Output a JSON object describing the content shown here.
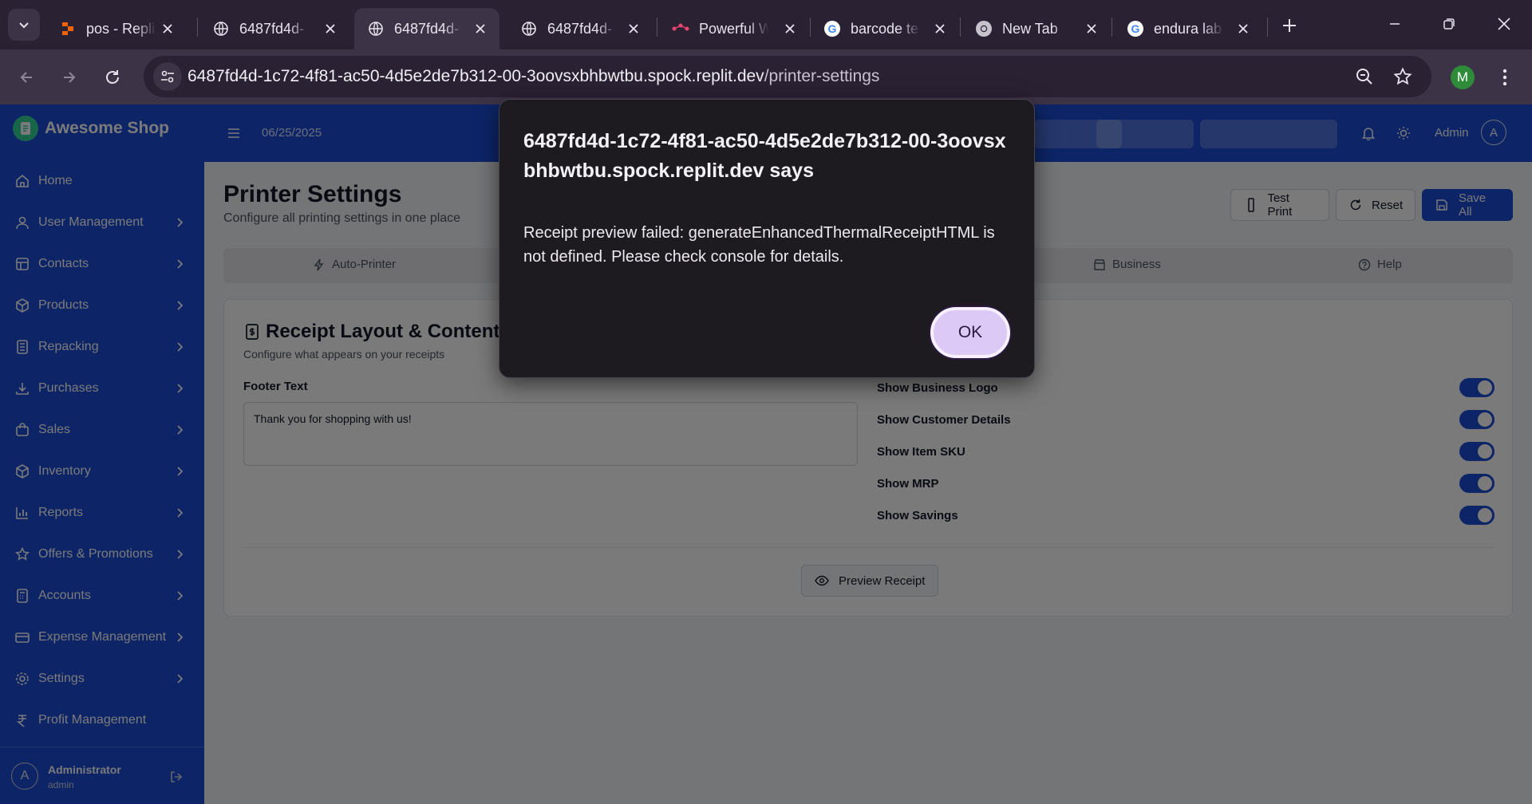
{
  "browser": {
    "tabs": [
      {
        "title": "pos - Replit",
        "icon": "replit-icon",
        "active": false
      },
      {
        "title": "6487fd4d-",
        "icon": "globe-icon",
        "active": false
      },
      {
        "title": "6487fd4d-",
        "icon": "globe-icon",
        "active": true
      },
      {
        "title": "6487fd4d-",
        "icon": "globe-icon",
        "active": false
      },
      {
        "title": "Powerful W",
        "icon": "flow-icon",
        "active": false
      },
      {
        "title": "barcode te",
        "icon": "google-icon",
        "active": false
      },
      {
        "title": "New Tab",
        "icon": "chrome-icon",
        "active": false
      },
      {
        "title": "endura lab",
        "icon": "google-icon",
        "active": false
      }
    ],
    "url_host": "6487fd4d-1c72-4f81-ac50-4d5e2de7b312-00-3oovsxbhbwtbu.spock.replit.dev",
    "url_path": "/printer-settings",
    "profile_initial": "M"
  },
  "app": {
    "brand": "Awesome Shop",
    "date": "06/25/2025",
    "top_user": "Admin",
    "top_avatar": "A",
    "nav": [
      {
        "label": "Home",
        "icon": "home-icon",
        "chevron": false
      },
      {
        "label": "User Management",
        "icon": "user-icon",
        "chevron": true
      },
      {
        "label": "Contacts",
        "icon": "contacts-icon",
        "chevron": true
      },
      {
        "label": "Products",
        "icon": "box-icon",
        "chevron": true
      },
      {
        "label": "Repacking",
        "icon": "repack-icon",
        "chevron": true
      },
      {
        "label": "Purchases",
        "icon": "download-icon",
        "chevron": true
      },
      {
        "label": "Sales",
        "icon": "bag-icon",
        "chevron": true
      },
      {
        "label": "Inventory",
        "icon": "box-icon",
        "chevron": true
      },
      {
        "label": "Reports",
        "icon": "bar-chart-icon",
        "chevron": true
      },
      {
        "label": "Offers & Promotions",
        "icon": "star-icon",
        "chevron": true
      },
      {
        "label": "Accounts",
        "icon": "calculator-icon",
        "chevron": true
      },
      {
        "label": "Expense Management",
        "icon": "wallet-icon",
        "chevron": true
      },
      {
        "label": "Settings",
        "icon": "gear-icon",
        "chevron": true
      },
      {
        "label": "Profit Management",
        "icon": "rupee-icon",
        "chevron": false
      }
    ],
    "user": {
      "initial": "A",
      "name": "Administrator",
      "role": "admin"
    }
  },
  "page": {
    "title": "Printer Settings",
    "subtitle": "Configure all printing settings in one place",
    "buttons": {
      "test_print": "Test Print",
      "reset": "Reset",
      "save_all": "Save All"
    },
    "tabs": [
      {
        "label": "Auto-Printer",
        "icon": "bolt-icon"
      },
      {
        "label": "Business",
        "icon": "store-icon"
      },
      {
        "label": "Help",
        "icon": "help-icon"
      }
    ],
    "card": {
      "title": "Receipt Layout & Content",
      "subtitle": "Configure what appears on your receipts",
      "footer_label": "Footer Text",
      "footer_value": "Thank you for shopping with us!",
      "toggles": [
        {
          "label": "Show Business Logo",
          "on": true
        },
        {
          "label": "Show Customer Details",
          "on": true
        },
        {
          "label": "Show Item SKU",
          "on": true
        },
        {
          "label": "Show MRP",
          "on": true
        },
        {
          "label": "Show Savings",
          "on": true
        }
      ],
      "preview_button": "Preview Receipt"
    }
  },
  "dialog": {
    "title": "6487fd4d-1c72-4f81-ac50-4d5e2de7b312-00-3oovsxbhbwtbu.spock.replit.dev says",
    "message": "Receipt preview failed: generateEnhancedThermalReceiptHTML is not defined. Please check console for details.",
    "ok_label": "OK"
  },
  "colors": {
    "chrome_dark": "#2a2133",
    "chrome_tab": "#3d3347",
    "app_primary": "#1d4ed8",
    "dialog_bg": "#1e1b20",
    "ok_button": "#dcc9f5"
  }
}
